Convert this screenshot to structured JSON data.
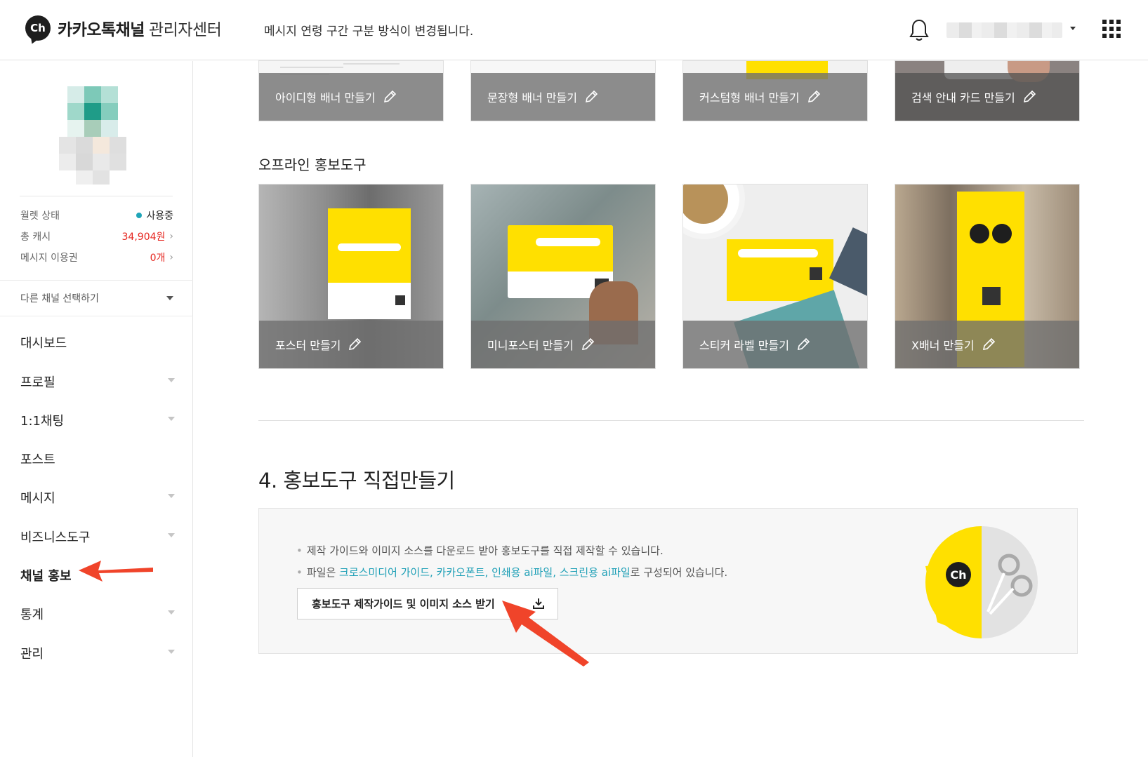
{
  "header": {
    "logo_badge": "Ch",
    "logo_name": "카카오톡채널",
    "logo_sub": "관리자센터",
    "notice": "메시지 연령 구간 구분 방식이 변경됩니다.",
    "icons": [
      "bell-icon",
      "apps-grid-icon"
    ]
  },
  "sidebar": {
    "wallet_label": "월렛 상태",
    "wallet_value": "사용중",
    "cash_label": "총 캐시",
    "cash_value": "34,904원",
    "voucher_label": "메시지 이용권",
    "voucher_value": "0개",
    "chevron": "›",
    "select_channel": "다른 채널 선택하기",
    "menu": [
      {
        "label": "대시보드",
        "expandable": false
      },
      {
        "label": "프로필",
        "expandable": true
      },
      {
        "label": "1:1채팅",
        "expandable": true
      },
      {
        "label": "포스트",
        "expandable": false
      },
      {
        "label": "메시지",
        "expandable": true
      },
      {
        "label": "비즈니스도구",
        "expandable": true
      },
      {
        "label": "채널 홍보",
        "expandable": false,
        "active": true
      },
      {
        "label": "통계",
        "expandable": true
      },
      {
        "label": "관리",
        "expandable": true
      }
    ]
  },
  "online_tools": [
    {
      "label": "아이디형 배너 만들기"
    },
    {
      "label": "문장형 배너 만들기"
    },
    {
      "label": "커스텀형 배너 만들기"
    },
    {
      "label": "검색 안내 카드 만들기"
    }
  ],
  "offline_section": {
    "title": "오프라인 홍보도구",
    "cards": [
      {
        "label": "포스터 만들기"
      },
      {
        "label": "미니포스터 만들기"
      },
      {
        "label": "스티커 라벨 만들기"
      },
      {
        "label": "X배너 만들기"
      }
    ]
  },
  "diy_section": {
    "title": "4. 홍보도구 직접만들기",
    "line1": "제작 가이드와 이미지 소스를 다운로드 받아 홍보도구를 직접 제작할 수 있습니다.",
    "line2_prefix": "파일은 ",
    "line2_links": "크로스미디어 가이드, 카카오폰트, 인쇄용 ai파일, 스크린용 ai파일",
    "line2_suffix": "로 구성되어 있습니다.",
    "button_label": "홍보도구 제작가이드 및 이미지 소스 받기",
    "badge": "Ch"
  },
  "colors": {
    "kakao_yellow": "#ffe000",
    "accent_teal": "#1d9fb6",
    "alert_red": "#e6261f",
    "arrow_red": "#f0442a"
  }
}
